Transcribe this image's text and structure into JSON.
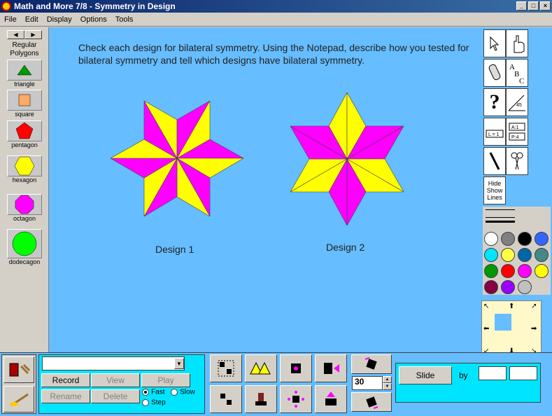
{
  "window": {
    "title": "Math and More 7/8 - Symmetry in Design"
  },
  "menu": [
    "File",
    "Edit",
    "Display",
    "Options",
    "Tools"
  ],
  "canvas": {
    "instructions": "Check each design for bilateral symmetry. Using the Notepad, describe how you tested for bilateral symmetry and tell which designs have bilateral symmetry.",
    "design1_label": "Design 1",
    "design2_label": "Design 2",
    "colors": {
      "background": "#66bdff",
      "yellow": "#ffff00",
      "magenta": "#ff00ff"
    }
  },
  "palette": {
    "title": "Regular Polygons",
    "items": [
      {
        "label": "triangle",
        "color": "#009900"
      },
      {
        "label": "square",
        "color": "#ffaa66"
      },
      {
        "label": "pentagon",
        "color": "#ff0000"
      },
      {
        "label": "hexagon",
        "color": "#ffff00"
      },
      {
        "label": "octagon",
        "color": "#ff00ff"
      },
      {
        "label": "dodecagon",
        "color": "#00ff00"
      }
    ]
  },
  "tools": {
    "hide_show_label": "Hide Show Lines",
    "ruler_label": "L = 1",
    "area_label": "A:1",
    "perim_label": "P:4",
    "tri_label": "45"
  },
  "colors": [
    "#ffffff",
    "#808080",
    "#000000",
    "#3366ff",
    "#00e5ff",
    "#ffff44",
    "#0066aa",
    "#448888",
    "#009900",
    "#ff0000",
    "#ff00ff",
    "#ffff00",
    "#880044",
    "#9900ff",
    "#c0c0c0"
  ],
  "recorder": {
    "record": "Record",
    "view": "View",
    "play": "Play",
    "rename": "Rename",
    "delete": "Delete",
    "fast": "Fast",
    "slow": "Slow",
    "step": "Step"
  },
  "transform": {
    "angle_value": "30"
  },
  "slide": {
    "label": "Slide",
    "by": "by"
  }
}
